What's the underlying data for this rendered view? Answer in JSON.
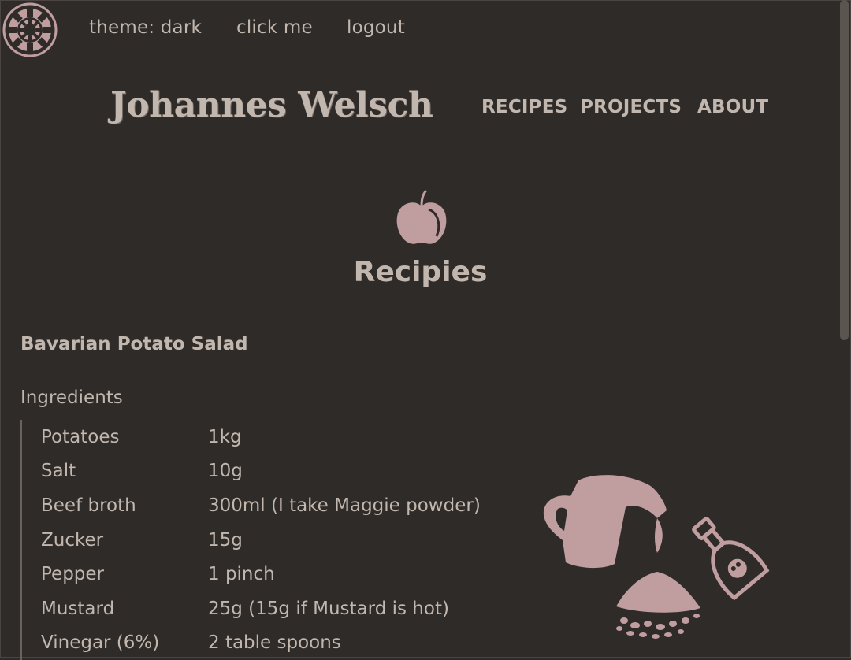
{
  "topbar": {
    "logo_icon": "gear-icon",
    "links": {
      "theme": "theme: dark",
      "click": "click me",
      "logout": "logout"
    }
  },
  "header": {
    "site_title": "Johannes Welsch",
    "nav": {
      "recipes": "RECIPES",
      "projects": "PROJECTS",
      "about": "ABOUT"
    }
  },
  "main": {
    "section_icon": "apple-icon",
    "section_heading": "Recipies",
    "recipe": {
      "title": "Bavarian Potato Salad",
      "ingredients_label": "Ingredients",
      "ingredients": [
        {
          "name": "Potatoes",
          "amount": "1kg"
        },
        {
          "name": "Salt",
          "amount": "10g"
        },
        {
          "name": "Beef broth",
          "amount": "300ml (I take Maggie powder)"
        },
        {
          "name": "Zucker",
          "amount": "15g"
        },
        {
          "name": "Pepper",
          "amount": "1 pinch"
        },
        {
          "name": "Mustard",
          "amount": "25g (15g if Mustard is hot)"
        },
        {
          "name": "Vinegar (6%)",
          "amount": "2 table spoons"
        }
      ]
    },
    "illustration_icon": "pitcher-and-bottle-illustration"
  },
  "colors": {
    "background": "#2f2b28",
    "text": "#c2b7ae",
    "accent": "#c09ea0"
  }
}
